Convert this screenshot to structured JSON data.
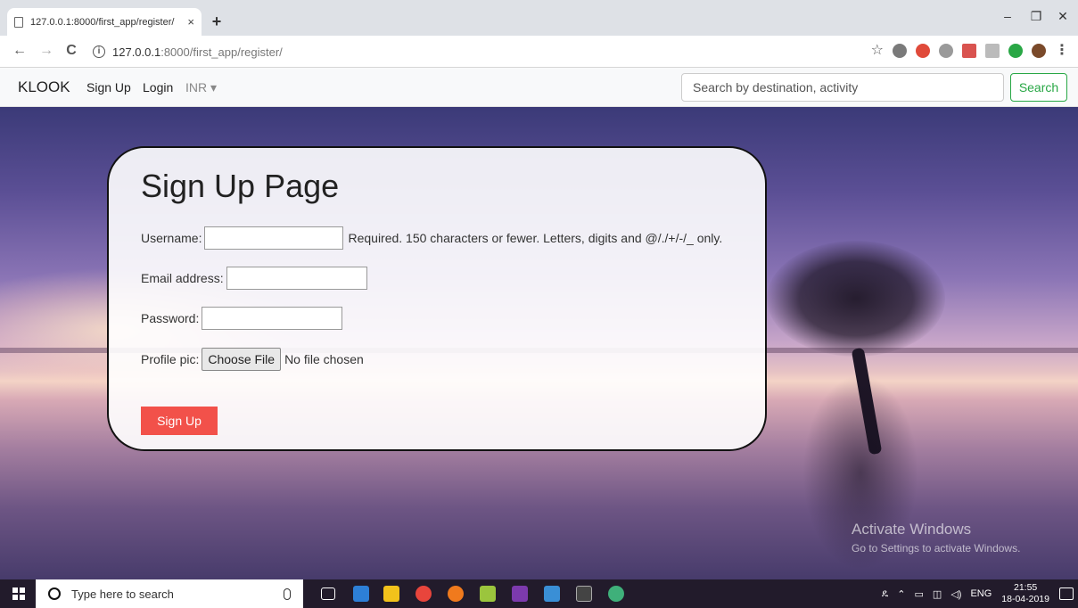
{
  "browser": {
    "tab_title": "127.0.0.1:8000/first_app/register/",
    "tab_close": "×",
    "new_tab": "+",
    "url_host": "127.0.0.1",
    "url_rest": ":8000/first_app/register/",
    "window_controls": {
      "minimize": "–",
      "maximize": "❐",
      "close": "✕"
    },
    "nav": {
      "back": "←",
      "forward": "→",
      "reload": "C"
    },
    "star": "☆",
    "menu": "⋮",
    "info": "i"
  },
  "site_nav": {
    "brand": "KLOOK",
    "signup": "Sign Up",
    "login": "Login",
    "currency": "INR ▾",
    "search_placeholder": "Search by destination, activity",
    "search_button": "Search"
  },
  "form": {
    "title": "Sign Up Page",
    "username_label": "Username:",
    "username_help": "Required. 150 characters or fewer. Letters, digits and @/./+/-/_ only.",
    "email_label": "Email address:",
    "password_label": "Password:",
    "profile_label": "Profile pic:",
    "choose_file": "Choose File",
    "file_status": "No file chosen",
    "submit": "Sign Up"
  },
  "watermark": {
    "line1": "Activate Windows",
    "line2": "Go to Settings to activate Windows."
  },
  "taskbar": {
    "search_placeholder": "Type here to search",
    "lang": "ENG",
    "time": "21:55",
    "date": "18-04-2019",
    "tray_icons": [
      "people-icon",
      "chevron-up-icon",
      "network-icon",
      "wifi-icon",
      "volume-icon"
    ]
  },
  "colors": {
    "search_green": "#28a745",
    "signup_red": "#f2514a",
    "taskbar": "#221b2b"
  }
}
